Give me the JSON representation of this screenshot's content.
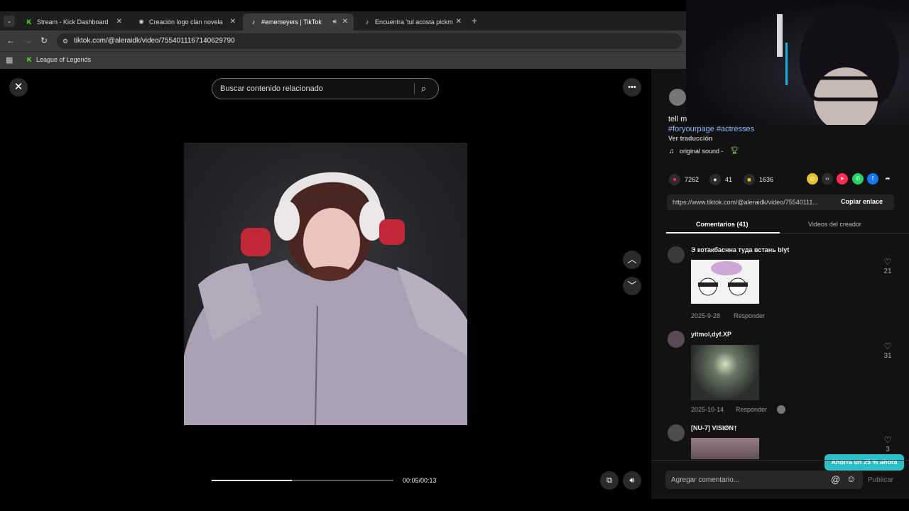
{
  "tabs": [
    {
      "title": "Stream - Kick Dashboard",
      "favicon": "kick-icon"
    },
    {
      "title": "Creación logo clan novela",
      "favicon": "openai-icon"
    },
    {
      "title": "#ememeyers | TikTok",
      "favicon": "tiktok-icon"
    },
    {
      "title": "Encuentra 'tul acosta pickme' e",
      "favicon": "tiktok-icon"
    }
  ],
  "url": "tiktok.com/@aleraidk/video/7554011167140629790",
  "bookmark": "League of Legends",
  "search": {
    "placeholder": "Buscar contenido relacionado"
  },
  "player": {
    "time": "00:05/00:13",
    "progress": 0.44
  },
  "post": {
    "caption_partial": "tell m",
    "hashtags": "#foryourpage #actresses",
    "translate": "Ver traducción",
    "sound": "original sound -"
  },
  "stats": {
    "likes": "7262",
    "comments": "41",
    "saves": "1636"
  },
  "link": {
    "url": "https://www.tiktok.com/@aleraidk/video/75540111...",
    "copy": "Copiar enlace"
  },
  "tabs_panel": {
    "comments": "Comentarios (41)",
    "creator_videos": "Videos del creador"
  },
  "comments": [
    {
      "user": "Э котакбаснна туда встань blyt",
      "date": "2025-9-28",
      "reply": "Responder",
      "likes": "21"
    },
    {
      "user": "yitmol,dyf.XP",
      "date": "2025-10-14",
      "reply": "Responder",
      "likes": "31"
    },
    {
      "user": "[NU-7] VISIØN†",
      "likes": "3"
    }
  ],
  "promo": "Ahorra un 25 % ahora",
  "composer": {
    "placeholder": "Agregar comentario...",
    "publish": "Publicar"
  },
  "colors": {
    "accent": "#fe2c55",
    "link": "#8fb8ff",
    "promo": "#2bc0c8"
  }
}
